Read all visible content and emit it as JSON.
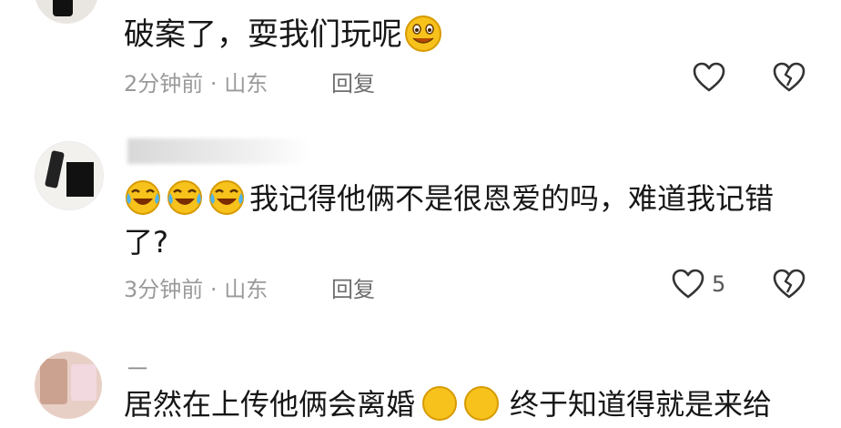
{
  "comments": [
    {
      "text": "破案了，耍我们玩呢",
      "time": "2分钟前",
      "separator": "·",
      "location": "山东",
      "reply_label": "回复",
      "likes": ""
    },
    {
      "text_line1": "我记得他俩不是很恩爱的吗，难道我记错",
      "text_line2": "了?",
      "time": "3分钟前",
      "separator": "·",
      "location": "山东",
      "reply_label": "回复",
      "likes": "5"
    },
    {
      "username": "一",
      "text_left": "居然在上传他俩会离婚",
      "text_right": "终于知道得就是来给"
    }
  ],
  "icons": {
    "like": "heart-outline-icon",
    "dislike": "broken-heart-icon",
    "emoji_smile": "smiling-face-emoji",
    "emoji_laugh": "laughing-crying-face-emoji"
  },
  "colors": {
    "text": "#161616",
    "meta": "#9a9a9a",
    "emoji_yellow": "#f7c21b"
  }
}
